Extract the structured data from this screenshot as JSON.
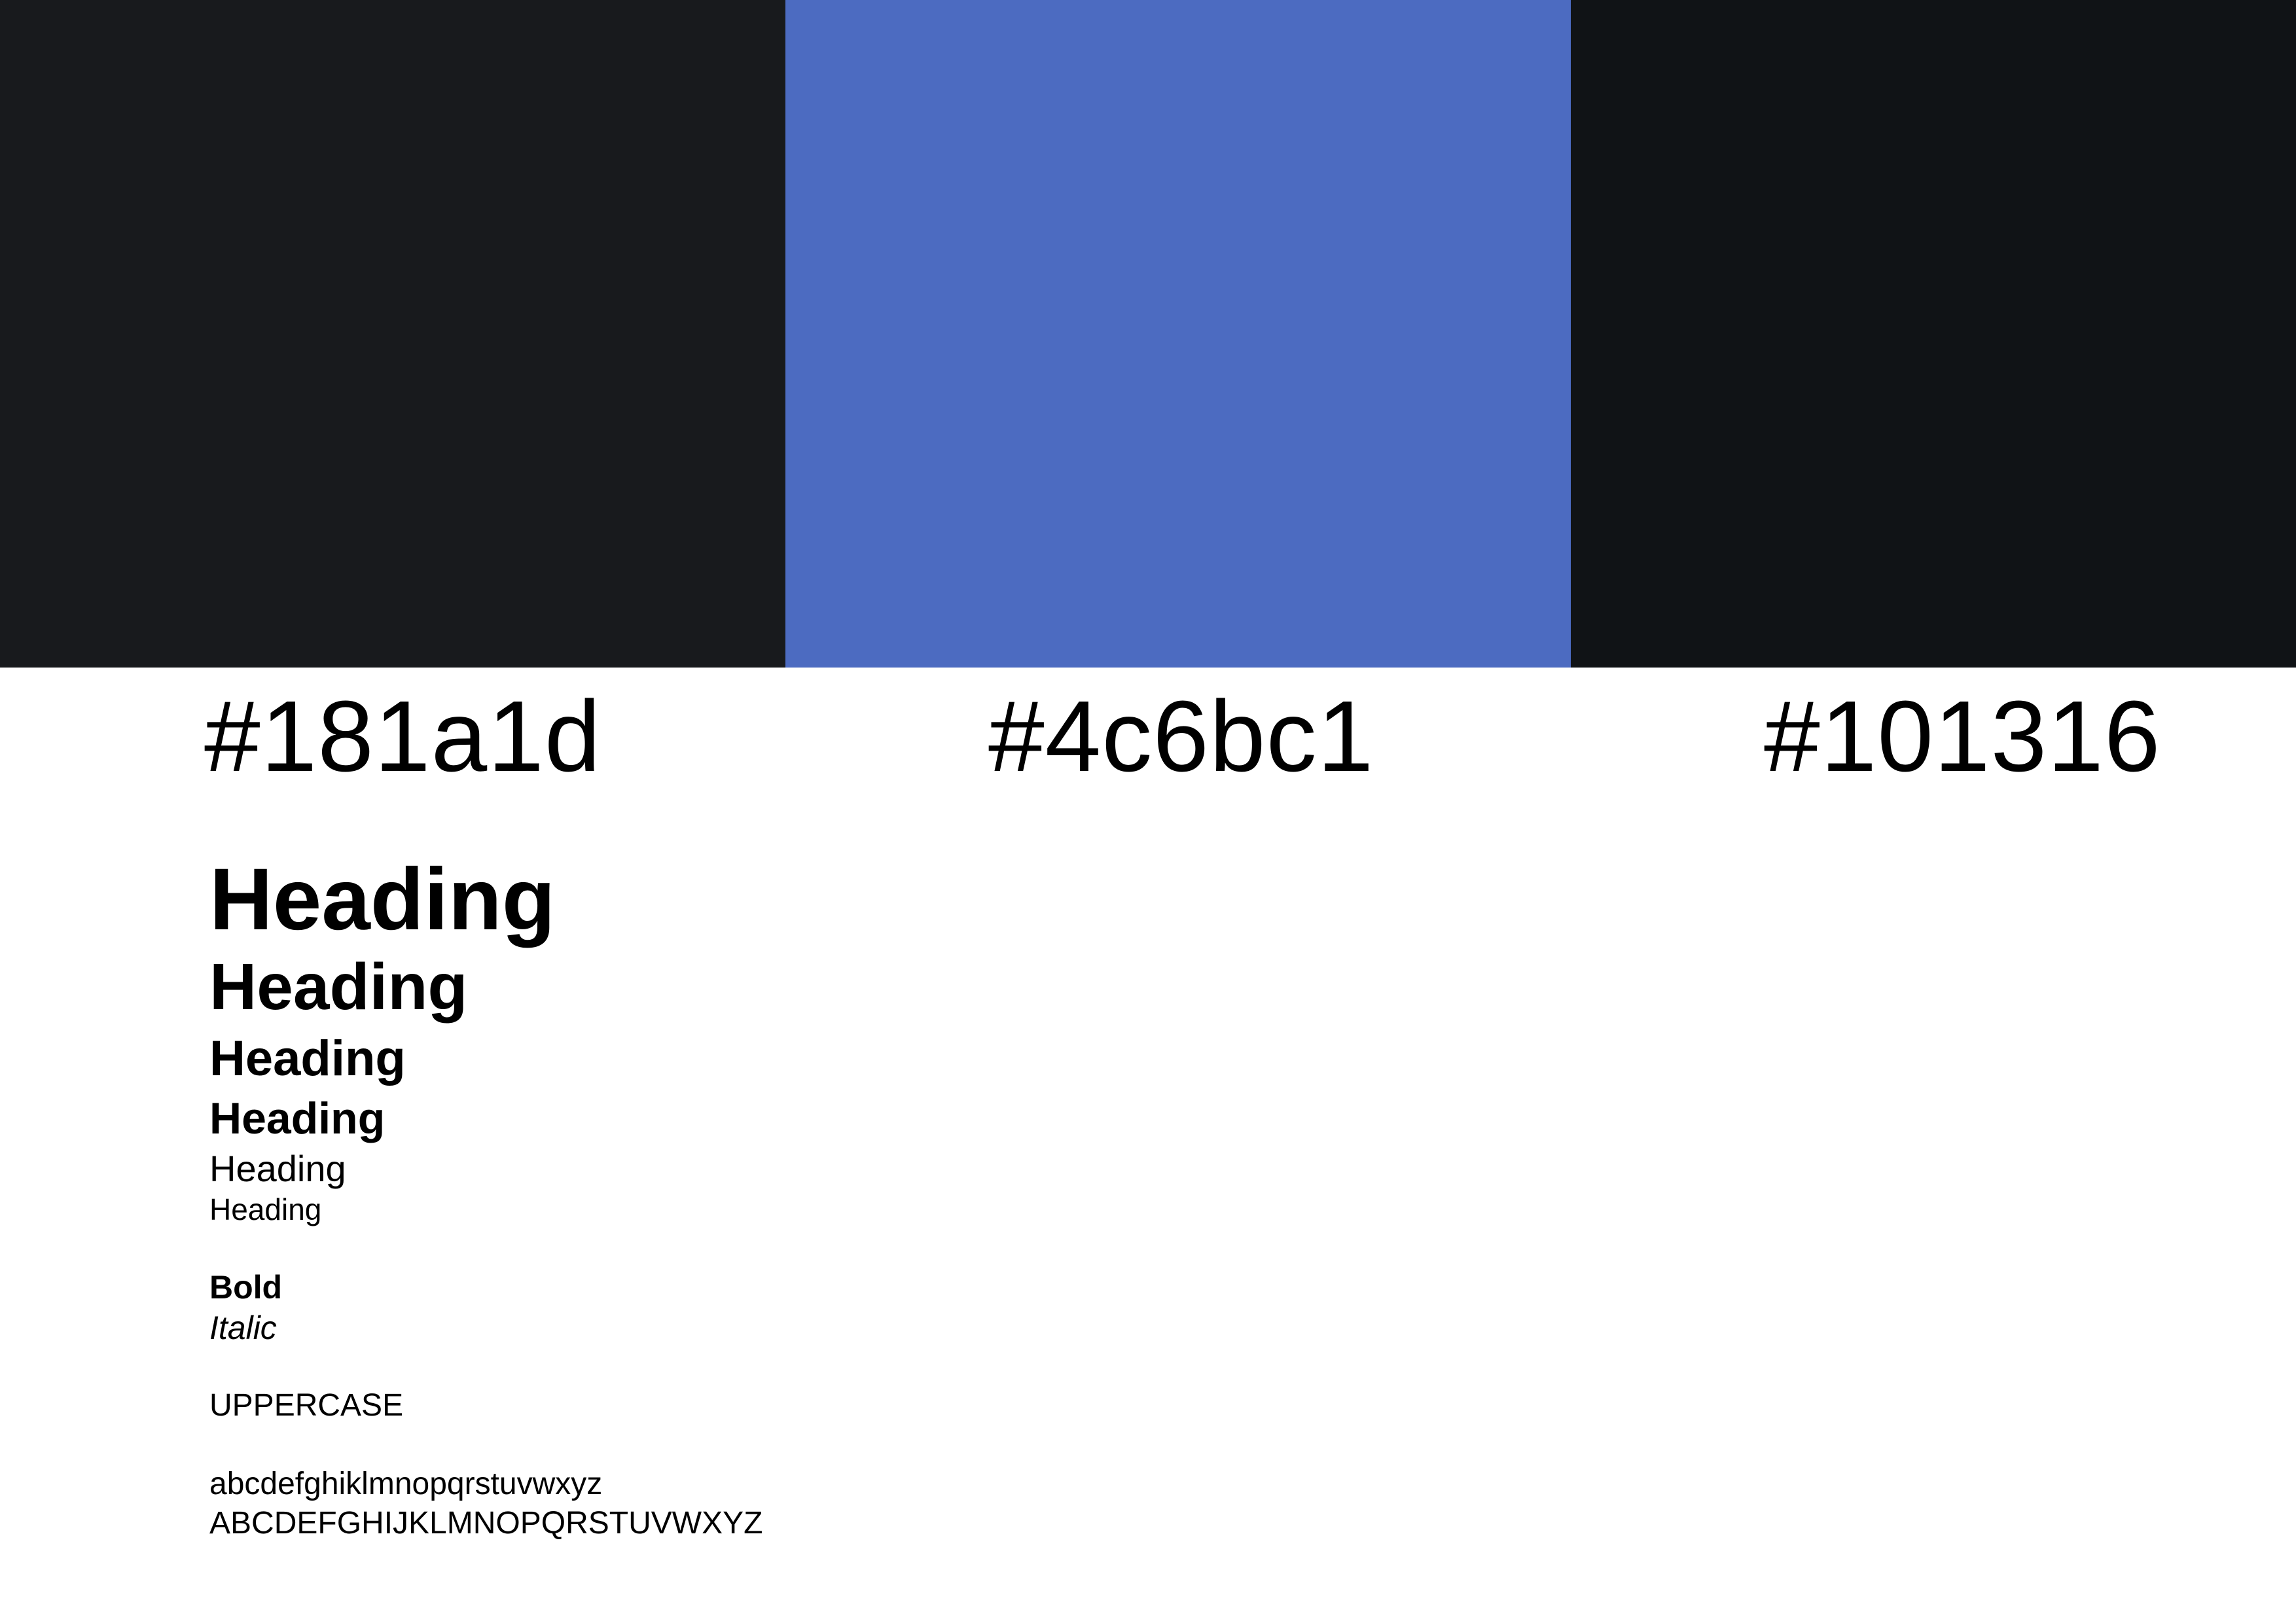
{
  "palette": {
    "colors": [
      {
        "hex": "#181a1d",
        "label": "#181a1d"
      },
      {
        "hex": "#4c6bc1",
        "label": "#4c6bc1"
      },
      {
        "hex": "#101316",
        "label": "#101316"
      }
    ]
  },
  "typography": {
    "headings": [
      "Heading",
      "Heading",
      "Heading",
      "Heading",
      "Heading",
      "Heading"
    ],
    "bold": "Bold",
    "italic": "Italic",
    "uppercase": "UPPERCASE",
    "lowercase_alphabet": "abcdefghiklmnopqrstuvwxyz",
    "uppercase_alphabet": "ABCDEFGHIJKLMNOPQRSTUVWXYZ"
  }
}
